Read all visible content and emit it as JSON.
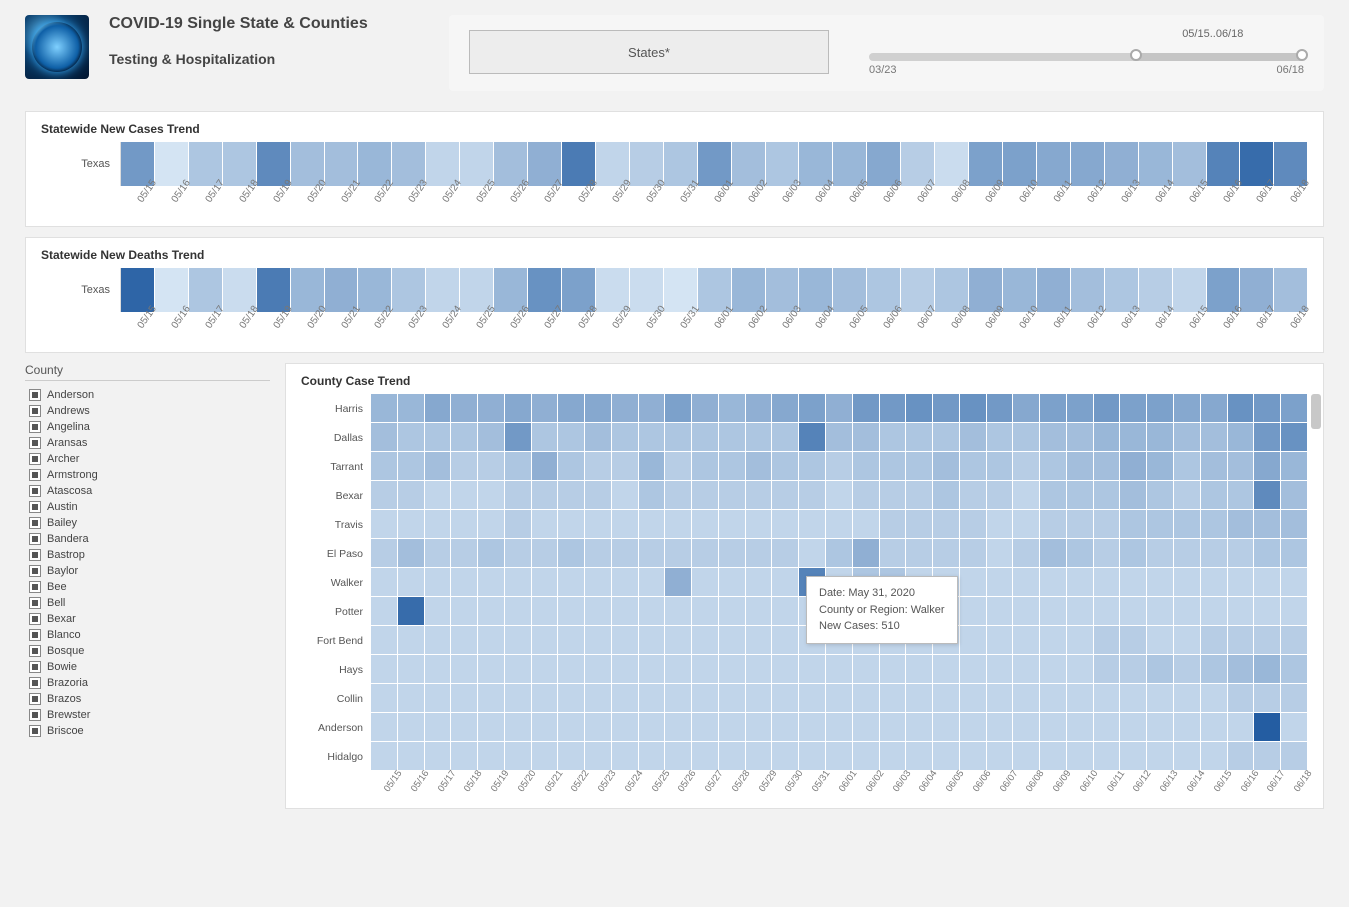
{
  "header": {
    "title": "COVID-19 Single State & Counties",
    "subtitle": "Testing & Hospitalization",
    "states_button": "States*",
    "slider": {
      "range_label": "05/15..06/18",
      "start_date": "03/23",
      "end_date": "06/18"
    }
  },
  "dates": [
    "05/15",
    "05/16",
    "05/17",
    "05/18",
    "05/19",
    "05/20",
    "05/21",
    "05/22",
    "05/23",
    "05/24",
    "05/25",
    "05/26",
    "05/27",
    "05/28",
    "05/29",
    "05/30",
    "05/31",
    "06/01",
    "06/02",
    "06/03",
    "06/04",
    "06/05",
    "06/06",
    "06/07",
    "06/08",
    "06/09",
    "06/10",
    "06/11",
    "06/12",
    "06/13",
    "06/14",
    "06/15",
    "06/16",
    "06/17",
    "06/18"
  ],
  "panel1": {
    "title": "Statewide New Cases Trend",
    "row_label": "Texas"
  },
  "panel2": {
    "title": "Statewide New Deaths Trend",
    "row_label": "Texas"
  },
  "county_filter": {
    "title": "County",
    "items": [
      "Anderson",
      "Andrews",
      "Angelina",
      "Aransas",
      "Archer",
      "Armstrong",
      "Atascosa",
      "Austin",
      "Bailey",
      "Bandera",
      "Bastrop",
      "Baylor",
      "Bee",
      "Bell",
      "Bexar",
      "Blanco",
      "Bosque",
      "Bowie",
      "Brazoria",
      "Brazos",
      "Brewster",
      "Briscoe"
    ]
  },
  "county_panel": {
    "title": "County Case Trend",
    "rows": [
      "Harris",
      "Dallas",
      "Tarrant",
      "Bexar",
      "Travis",
      "El Paso",
      "Walker",
      "Potter",
      "Fort Bend",
      "Hays",
      "Collin",
      "Anderson",
      "Hidalgo"
    ]
  },
  "tooltip": {
    "line1": "Date: May 31, 2020",
    "line2": "County or Region: Walker",
    "line3": "New Cases:  510"
  },
  "chart_data": [
    {
      "type": "heatmap",
      "title": "Statewide New Cases Trend",
      "xlabel": "",
      "ylabel": "",
      "categories": [
        "05/15",
        "05/16",
        "05/17",
        "05/18",
        "05/19",
        "05/20",
        "05/21",
        "05/22",
        "05/23",
        "05/24",
        "05/25",
        "05/26",
        "05/27",
        "05/28",
        "05/29",
        "05/30",
        "05/31",
        "06/01",
        "06/02",
        "06/03",
        "06/04",
        "06/05",
        "06/06",
        "06/07",
        "06/08",
        "06/09",
        "06/10",
        "06/11",
        "06/12",
        "06/13",
        "06/14",
        "06/15",
        "06/16",
        "06/17",
        "06/18"
      ],
      "series": [
        {
          "name": "Texas",
          "values": [
            55,
            5,
            25,
            25,
            65,
            30,
            30,
            35,
            30,
            15,
            15,
            30,
            40,
            75,
            15,
            20,
            25,
            55,
            30,
            25,
            35,
            35,
            45,
            20,
            10,
            50,
            50,
            45,
            45,
            40,
            35,
            30,
            70,
            85,
            65
          ]
        }
      ],
      "note": "values are relative intensity 0-100 estimated from cell shading"
    },
    {
      "type": "heatmap",
      "title": "Statewide New Deaths Trend",
      "xlabel": "",
      "ylabel": "",
      "categories": [
        "05/15",
        "05/16",
        "05/17",
        "05/18",
        "05/19",
        "05/20",
        "05/21",
        "05/22",
        "05/23",
        "05/24",
        "05/25",
        "05/26",
        "05/27",
        "05/28",
        "05/29",
        "05/30",
        "05/31",
        "06/01",
        "06/02",
        "06/03",
        "06/04",
        "06/05",
        "06/06",
        "06/07",
        "06/08",
        "06/09",
        "06/10",
        "06/11",
        "06/12",
        "06/13",
        "06/14",
        "06/15",
        "06/16",
        "06/17",
        "06/18"
      ],
      "series": [
        {
          "name": "Texas",
          "values": [
            90,
            5,
            25,
            10,
            75,
            35,
            40,
            35,
            25,
            15,
            15,
            35,
            60,
            50,
            10,
            10,
            5,
            25,
            35,
            30,
            35,
            30,
            25,
            20,
            25,
            40,
            35,
            40,
            30,
            25,
            20,
            15,
            50,
            40,
            30
          ]
        }
      ],
      "note": "values are relative intensity 0-100 estimated from cell shading"
    },
    {
      "type": "heatmap",
      "title": "County Case Trend",
      "xlabel": "",
      "ylabel": "",
      "categories": [
        "05/15",
        "05/16",
        "05/17",
        "05/18",
        "05/19",
        "05/20",
        "05/21",
        "05/22",
        "05/23",
        "05/24",
        "05/25",
        "05/26",
        "05/27",
        "05/28",
        "05/29",
        "05/30",
        "05/31",
        "06/01",
        "06/02",
        "06/03",
        "06/04",
        "06/05",
        "06/06",
        "06/07",
        "06/08",
        "06/09",
        "06/10",
        "06/11",
        "06/12",
        "06/13",
        "06/14",
        "06/15",
        "06/16",
        "06/17",
        "06/18"
      ],
      "series": [
        {
          "name": "Harris",
          "values": [
            35,
            35,
            45,
            40,
            40,
            45,
            40,
            45,
            45,
            40,
            40,
            50,
            40,
            35,
            40,
            45,
            50,
            40,
            55,
            55,
            60,
            55,
            60,
            55,
            45,
            50,
            50,
            55,
            50,
            50,
            45,
            45,
            60,
            55,
            50
          ]
        },
        {
          "name": "Dallas",
          "values": [
            30,
            25,
            25,
            25,
            30,
            55,
            25,
            25,
            30,
            25,
            25,
            25,
            25,
            25,
            25,
            25,
            70,
            30,
            30,
            25,
            25,
            25,
            30,
            25,
            25,
            30,
            30,
            35,
            35,
            35,
            30,
            30,
            35,
            55,
            60
          ]
        },
        {
          "name": "Tarrant",
          "values": [
            25,
            25,
            30,
            20,
            20,
            25,
            40,
            25,
            20,
            20,
            35,
            20,
            25,
            25,
            30,
            25,
            25,
            20,
            25,
            25,
            25,
            30,
            25,
            25,
            20,
            25,
            30,
            30,
            40,
            35,
            25,
            30,
            30,
            45,
            35
          ]
        },
        {
          "name": "Bexar",
          "values": [
            20,
            20,
            15,
            15,
            15,
            20,
            20,
            20,
            20,
            15,
            25,
            20,
            20,
            20,
            20,
            20,
            20,
            15,
            20,
            20,
            20,
            25,
            20,
            20,
            15,
            25,
            25,
            25,
            30,
            25,
            20,
            25,
            25,
            65,
            30
          ]
        },
        {
          "name": "Travis",
          "values": [
            15,
            15,
            15,
            15,
            15,
            20,
            15,
            15,
            15,
            15,
            15,
            15,
            15,
            15,
            15,
            15,
            15,
            15,
            15,
            20,
            20,
            20,
            20,
            15,
            15,
            20,
            20,
            20,
            25,
            25,
            25,
            25,
            30,
            30,
            30
          ]
        },
        {
          "name": "El Paso",
          "values": [
            20,
            30,
            20,
            20,
            25,
            20,
            20,
            25,
            20,
            20,
            20,
            20,
            20,
            20,
            20,
            20,
            15,
            25,
            40,
            20,
            20,
            20,
            20,
            15,
            20,
            30,
            25,
            20,
            25,
            20,
            20,
            20,
            20,
            25,
            25
          ]
        },
        {
          "name": "Walker",
          "values": [
            15,
            15,
            15,
            15,
            15,
            15,
            15,
            15,
            15,
            15,
            15,
            40,
            15,
            15,
            15,
            15,
            70,
            15,
            25,
            25,
            15,
            15,
            15,
            15,
            15,
            15,
            15,
            15,
            15,
            15,
            15,
            15,
            15,
            15,
            15
          ]
        },
        {
          "name": "Potter",
          "values": [
            15,
            85,
            15,
            15,
            15,
            15,
            15,
            15,
            15,
            15,
            15,
            15,
            15,
            15,
            15,
            15,
            15,
            15,
            15,
            15,
            15,
            15,
            15,
            15,
            15,
            15,
            15,
            15,
            15,
            15,
            15,
            15,
            15,
            15,
            15
          ]
        },
        {
          "name": "Fort Bend",
          "values": [
            15,
            15,
            15,
            15,
            15,
            15,
            15,
            15,
            15,
            15,
            15,
            15,
            15,
            15,
            15,
            15,
            15,
            15,
            15,
            15,
            15,
            15,
            15,
            15,
            15,
            15,
            15,
            20,
            20,
            15,
            15,
            20,
            20,
            20,
            20
          ]
        },
        {
          "name": "Hays",
          "values": [
            15,
            15,
            15,
            15,
            15,
            15,
            15,
            15,
            15,
            15,
            15,
            15,
            15,
            15,
            15,
            15,
            15,
            15,
            15,
            15,
            15,
            15,
            15,
            15,
            15,
            15,
            15,
            20,
            20,
            25,
            20,
            25,
            30,
            35,
            25
          ]
        },
        {
          "name": "Collin",
          "values": [
            15,
            15,
            15,
            15,
            15,
            15,
            15,
            15,
            15,
            15,
            15,
            15,
            15,
            15,
            15,
            15,
            15,
            15,
            15,
            15,
            15,
            15,
            15,
            15,
            15,
            15,
            15,
            15,
            15,
            15,
            15,
            15,
            20,
            20,
            20
          ]
        },
        {
          "name": "Anderson",
          "values": [
            15,
            15,
            15,
            15,
            15,
            15,
            15,
            15,
            15,
            15,
            15,
            15,
            15,
            15,
            15,
            15,
            15,
            15,
            15,
            15,
            15,
            15,
            15,
            15,
            15,
            15,
            15,
            15,
            15,
            15,
            15,
            15,
            15,
            95,
            15
          ]
        },
        {
          "name": "Hidalgo",
          "values": [
            15,
            15,
            15,
            15,
            15,
            15,
            15,
            15,
            15,
            15,
            15,
            15,
            15,
            15,
            15,
            15,
            15,
            15,
            15,
            15,
            15,
            15,
            15,
            15,
            15,
            15,
            15,
            15,
            15,
            15,
            15,
            15,
            20,
            20,
            20
          ]
        }
      ],
      "tooltip_example": {
        "date": "May 31, 2020",
        "county": "Walker",
        "new_cases": 510
      },
      "note": "values are relative intensity 0-100 estimated from shading; Walker 05/31 corresponds to 510 new cases per tooltip"
    }
  ]
}
